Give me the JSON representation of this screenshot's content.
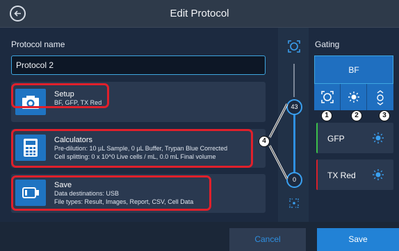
{
  "header": {
    "title": "Edit Protocol"
  },
  "protocol_name": {
    "label": "Protocol name",
    "value": "Protocol 2"
  },
  "cards": {
    "setup": {
      "title": "Setup",
      "subtitle": "BF, GFP, TX Red",
      "icon": "camera-icon"
    },
    "calculators": {
      "title": "Calculators",
      "line1": "Pre-dilution: 10 µL Sample, 0 µL Buffer, Trypan Blue Corrected",
      "line2": "Cell splitting: 0 x 10^0 Live cells / mL, 0.0 mL Final volume",
      "icon": "calculator-icon"
    },
    "save": {
      "title": "Save",
      "line1": "Data destinations: USB",
      "line2": "File types: Result, Images, Report, CSV, Cell Data",
      "icon": "usb-drive-icon"
    }
  },
  "slider": {
    "upper_value": "43",
    "lower_value": "0"
  },
  "gating": {
    "label": "Gating",
    "selected": "BF",
    "channels": [
      "GFP",
      "TX Red"
    ],
    "sub_icons": [
      "focus-icon",
      "brightness-icon",
      "contrast-icon"
    ]
  },
  "callouts": [
    "1",
    "2",
    "3",
    "4"
  ],
  "footer": {
    "cancel_label": "Cancel",
    "save_label": "Save"
  },
  "colors": {
    "accent": "#2282d6",
    "highlight": "#e0202b",
    "background": "#1c2a40"
  }
}
